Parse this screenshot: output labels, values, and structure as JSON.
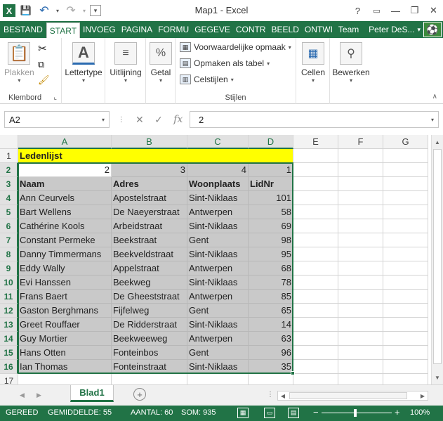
{
  "window": {
    "title": "Map1 - Excel",
    "help": "?",
    "minimize": "—",
    "restore": "❐",
    "close": "✕"
  },
  "qat": {
    "app_icon": "X",
    "save": "💾",
    "undo": "↶",
    "redo": "↷",
    "customize": "▾"
  },
  "tabs": [
    "BESTAND",
    "START",
    "INVOEG",
    "PAGINA",
    "FORMU",
    "GEGEVE",
    "CONTR",
    "BEELD",
    "ONTWI",
    "Team"
  ],
  "active_tab": "START",
  "user": {
    "name": "Peter DeS...",
    "caret": "▾"
  },
  "ribbon": {
    "clipboard": {
      "paste": "Plakken",
      "label": "Klembord"
    },
    "font": {
      "label": "Lettertype"
    },
    "alignment": {
      "label": "Uitlijning"
    },
    "number": {
      "label": "Getal",
      "icon_text": "%"
    },
    "styles": {
      "conditional": "Voorwaardelijke opmaak",
      "table": "Opmaken als tabel",
      "cell_styles": "Celstijlen",
      "label": "Stijlen"
    },
    "cells": {
      "label": "Cellen"
    },
    "editing": {
      "label": "Bewerken"
    }
  },
  "formula_bar": {
    "name_box": "A2",
    "cancel": "✕",
    "enter": "✓",
    "fx": "fx",
    "value": "2"
  },
  "columns": [
    "A",
    "B",
    "C",
    "D",
    "E",
    "F",
    "G"
  ],
  "selected_columns": [
    "A",
    "B",
    "C",
    "D"
  ],
  "rows": [
    "1",
    "2",
    "3",
    "4",
    "5",
    "6",
    "7",
    "8",
    "9",
    "10",
    "11",
    "12",
    "13",
    "14",
    "15",
    "16",
    "17"
  ],
  "selected_rows": [
    "2",
    "3",
    "4",
    "5",
    "6",
    "7",
    "8",
    "9",
    "10",
    "11",
    "12",
    "13",
    "14",
    "15",
    "16"
  ],
  "sheet": {
    "title": "Ledenlijst",
    "sort_row": [
      "2",
      "3",
      "4",
      "1"
    ],
    "headers": [
      "Naam",
      "Adres",
      "Woonplaats",
      "LidNr"
    ],
    "records": [
      [
        "Ann Ceurvels",
        "Apostelstraat",
        "Sint-Niklaas",
        "101"
      ],
      [
        "Bart Wellens",
        "De Naeyerstraat",
        "Antwerpen",
        "58"
      ],
      [
        "Cathérine Kools",
        "Arbeidstraat",
        "Sint-Niklaas",
        "69"
      ],
      [
        "Constant Permeke",
        "Beekstraat",
        "Gent",
        "98"
      ],
      [
        "Danny Timmermans",
        "Beekveldstraat",
        "Sint-Niklaas",
        "95"
      ],
      [
        "Eddy Wally",
        "Appelstraat",
        "Antwerpen",
        "68"
      ],
      [
        "Evi Hanssen",
        "Beekweg",
        "Sint-Niklaas",
        "78"
      ],
      [
        "Frans Baert",
        "De Gheeststraat",
        "Antwerpen",
        "85"
      ],
      [
        "Gaston Berghmans",
        "Fijfelweg",
        "Gent",
        "65"
      ],
      [
        "Greet Rouffaer",
        "De Ridderstraat",
        "Sint-Niklaas",
        "14"
      ],
      [
        "Guy Mortier",
        "Beekweeweg",
        "Antwerpen",
        "63"
      ],
      [
        "Hans Otten",
        "Fonteinbos",
        "Gent",
        "96"
      ],
      [
        "Ian Thomas",
        "Fonteinstraat",
        "Sint-Niklaas",
        "35"
      ]
    ]
  },
  "sheet_tabs": {
    "active": "Blad1",
    "add": "+"
  },
  "status": {
    "mode": "GEREED",
    "average": "GEMIDDELDE: 55",
    "count": "AANTAL: 60",
    "sum": "SOM: 935",
    "zoom_minus": "−",
    "zoom_plus": "+",
    "zoom": "100%"
  },
  "colors": {
    "accent": "#217346",
    "highlight_yellow": "#ffff00",
    "selection_gray": "#c9c9c9"
  }
}
